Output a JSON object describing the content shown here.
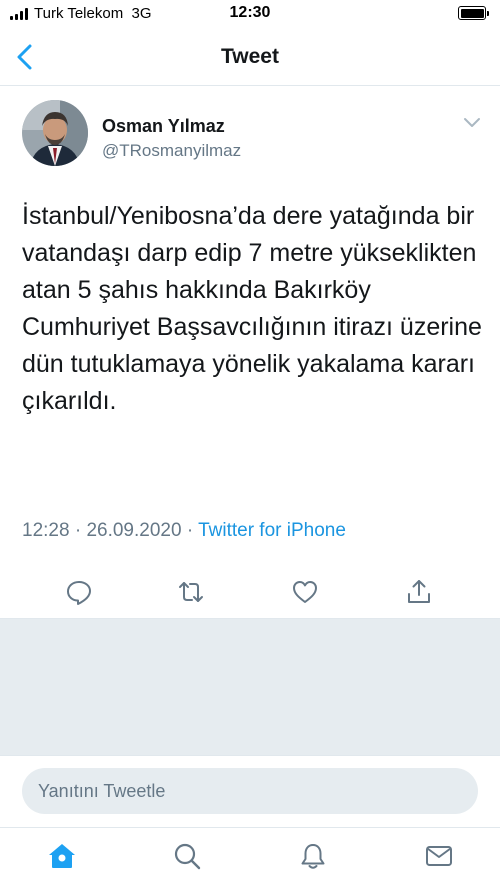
{
  "status_bar": {
    "carrier": "Turk Telekom",
    "network": "3G",
    "time": "12:30"
  },
  "nav": {
    "title": "Tweet",
    "icons": {
      "back": "chevron-left-icon"
    }
  },
  "tweet": {
    "author_name": "Osman Yılmaz",
    "author_handle": "@TRosmanyilmaz",
    "text": "İstanbul/Yenibosna’da dere yatağında bir vatandaşı darp edip 7 metre yükseklikten atan 5 şahıs hakkında Bakırköy Cumhuriyet Başsavcılığının itirazı üzerine dün tutuklamaya yönelik yakalama kararı çıkarıldı.",
    "time": "12:28",
    "date": "26.09.2020",
    "separator": "·",
    "source": "Twitter for iPhone",
    "actions": [
      "reply-icon",
      "retweet-icon",
      "like-icon",
      "share-icon"
    ]
  },
  "reply": {
    "placeholder": "Yanıtını Tweetle"
  },
  "tabs": [
    "home-icon",
    "search-icon",
    "notifications-icon",
    "messages-icon"
  ],
  "colors": {
    "accent": "#1da1f2",
    "link": "#1b95e0",
    "secondary_text": "#657786",
    "icon_gray": "#657786",
    "background_gray": "#e6ecf0",
    "divider": "#e1e8ed"
  }
}
